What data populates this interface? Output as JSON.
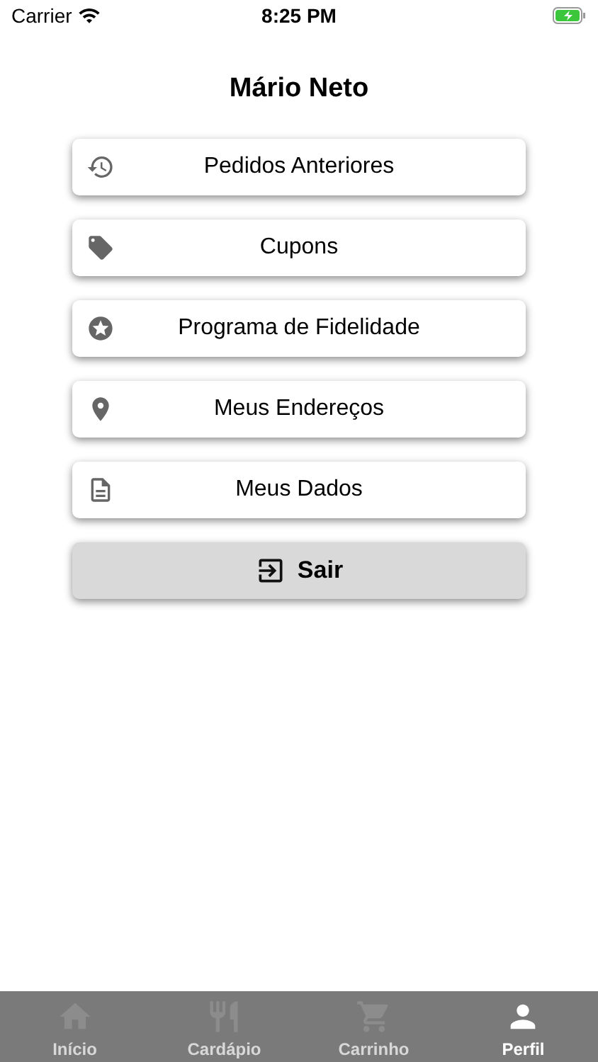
{
  "status_bar": {
    "carrier": "Carrier",
    "time": "8:25 PM"
  },
  "title": "Mário Neto",
  "menu": [
    {
      "kind": "history",
      "label": "Pedidos Anteriores"
    },
    {
      "kind": "coupon",
      "label": "Cupons"
    },
    {
      "kind": "loyalty",
      "label": "Programa de Fidelidade"
    },
    {
      "kind": "address",
      "label": "Meus Endereços"
    },
    {
      "kind": "data",
      "label": "Meus Dados"
    }
  ],
  "logout": {
    "label": "Sair"
  },
  "tabs": [
    {
      "kind": "home",
      "label": "Início",
      "selected": false
    },
    {
      "kind": "menu",
      "label": "Cardápio",
      "selected": false
    },
    {
      "kind": "cart",
      "label": "Carrinho",
      "selected": false
    },
    {
      "kind": "profile",
      "label": "Perfil",
      "selected": true
    }
  ]
}
